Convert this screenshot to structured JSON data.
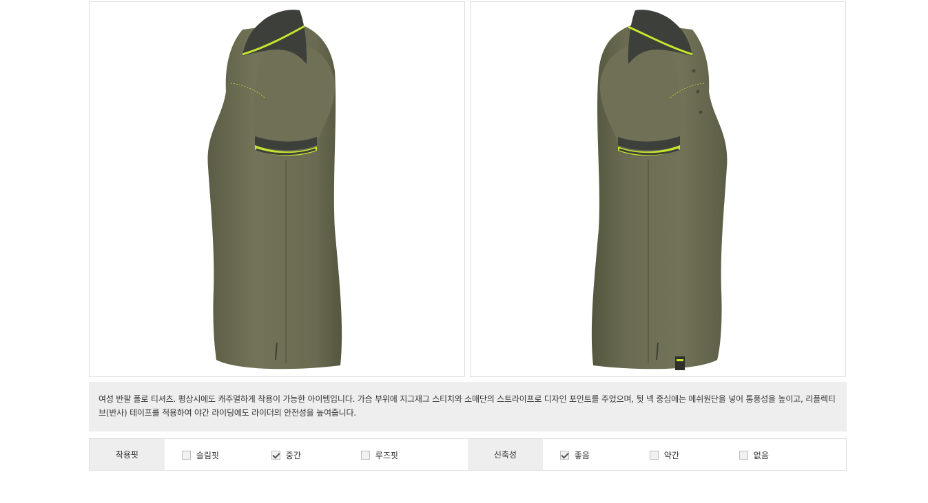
{
  "product": {
    "images": [
      {
        "view": "left-side",
        "alt": ""
      },
      {
        "view": "right-side",
        "alt": ""
      }
    ],
    "description": "여성 반팔 폴로 티셔츠. 평상시에도 캐주얼하게 착용이 가능한 아이템입니다. 가슴 부위에 지그재그 스티치와 소매단의 스트라이프로 디자인 포인트를 주었으며, 뒷 넥 중심에는 메쉬원단을 넣어 통풍성을 높이고, 리플렉티브(반사) 테이프를 적용하여 야간 라이딩에도 라이더의 안전성을 높여줍니다.",
    "colors": {
      "shirt": "#6b6b52",
      "collar": "#3c3f3a",
      "accent": "#c8e62e"
    }
  },
  "specs": {
    "fit": {
      "label": "착용핏",
      "options": [
        {
          "label": "슬림핏",
          "checked": false
        },
        {
          "label": "중간",
          "checked": true
        },
        {
          "label": "루즈핏",
          "checked": false
        }
      ]
    },
    "stretch": {
      "label": "신축성",
      "options": [
        {
          "label": "좋음",
          "checked": true
        },
        {
          "label": "약간",
          "checked": false
        },
        {
          "label": "없음",
          "checked": false
        }
      ]
    }
  }
}
